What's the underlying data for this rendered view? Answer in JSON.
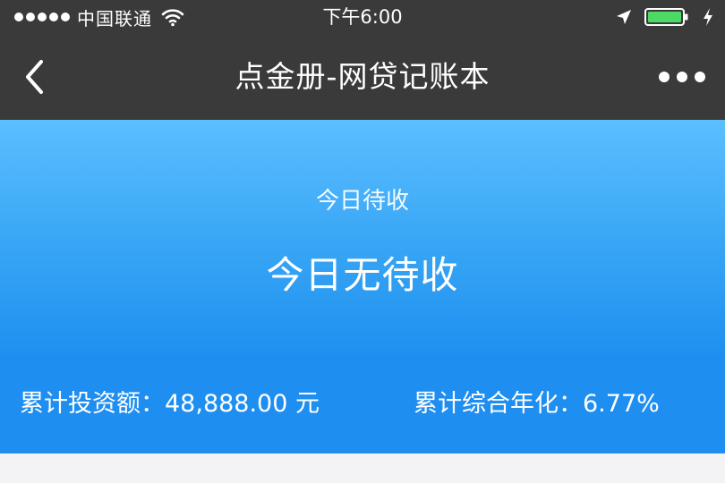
{
  "status_bar": {
    "carrier": "中国联通",
    "time": "下午6:00",
    "icons": [
      "signal-dots",
      "wifi-icon",
      "location-icon",
      "battery-icon",
      "charging-icon"
    ],
    "battery_color": "#4cd964"
  },
  "nav": {
    "title": "点金册-网贷记账本",
    "back_icon": "chevron-left-icon",
    "more_icon": "more-dots-icon"
  },
  "summary": {
    "label": "今日待收",
    "value": "今日无待收"
  },
  "stats": {
    "total_invest": "累计投资额：48,888.00 元",
    "annual_rate": "累计综合年化：6.77%"
  },
  "colors": {
    "header_bg": "#3b3a3a",
    "panel_top": "#5bbfff",
    "panel_bottom": "#1e8ef0",
    "page_bg": "#f3f3f5"
  }
}
